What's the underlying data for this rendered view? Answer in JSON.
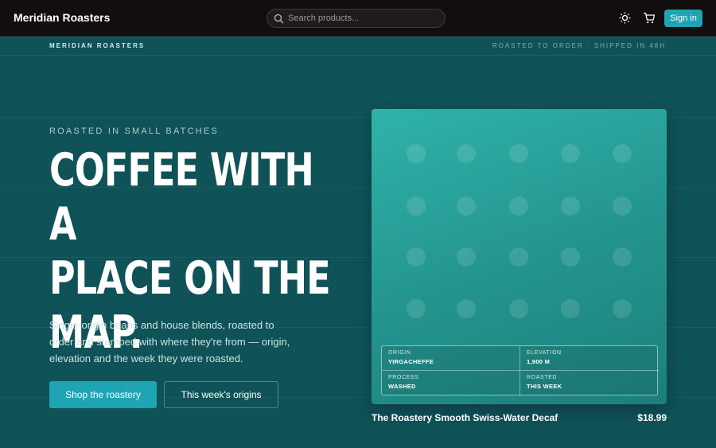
{
  "nav": {
    "brand": "Meridian Roasters",
    "search_placeholder": "Search products...",
    "signin_label": "Sign in",
    "icons": [
      "search-icon",
      "sun-icon",
      "cart-icon"
    ]
  },
  "subbar": {
    "left": "MERIDIAN ROASTERS",
    "right": "ROASTED TO ORDER · SHIPPED IN 48H"
  },
  "hero": {
    "eyebrow": "ROASTED IN SMALL BATCHES",
    "headline_line1": "COFFEE WITH A",
    "headline_line2": "PLACE ON THE",
    "headline_line3": "MAP.",
    "subtitle": "Single-origin beans and house blends, roasted to order and stamped with where they're from — origin, elevation and the week they were roasted.",
    "primary_cta": "Shop the roastery",
    "secondary_cta": "This week's origins"
  },
  "product": {
    "name": "The Roastery Smooth Swiss-Water Decaf",
    "price": "$18.99",
    "meta": {
      "origin_label": "ORIGIN",
      "origin_value": "YIRGACHEFFE",
      "elevation_label": "ELEVATION",
      "elevation_value": "1,900 M",
      "process_label": "PROCESS",
      "process_value": "WASHED",
      "roasted_label": "ROASTED",
      "roasted_value": "THIS WEEK"
    }
  },
  "colors": {
    "accent": "#1fa4b3",
    "background": "#0f5257",
    "nav_bg": "#120e0d",
    "card": "#2fb3aa"
  }
}
